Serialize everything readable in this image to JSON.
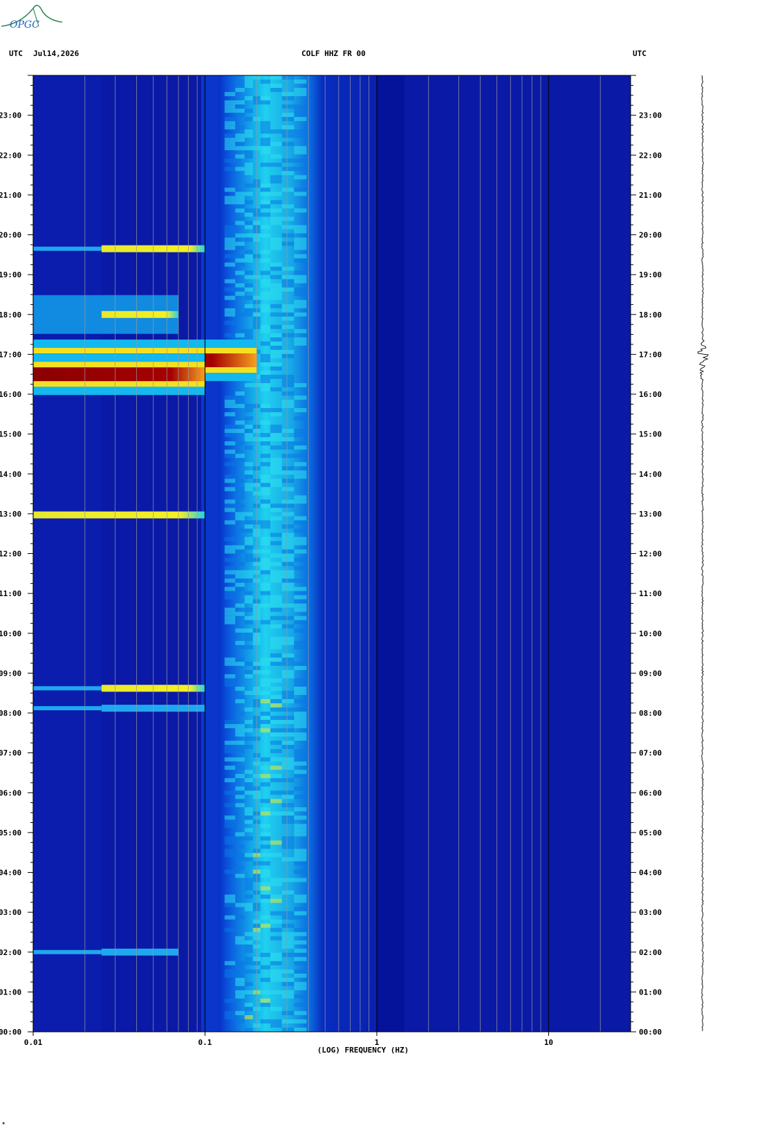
{
  "header": {
    "left_utc": "UTC",
    "date": "Jul14,2026",
    "station": "COLF HHZ FR 00",
    "right_utc": "UTC"
  },
  "logo": {
    "text": "OPGC",
    "color": "#2e8b57",
    "text_color": "#1e5fbf"
  },
  "colors": {
    "background": "#0a1aa6",
    "quiet_band": "#0825b8",
    "cyan": "#1fc8e8",
    "yellow": "#f5f020",
    "red": "#8b0000",
    "grid_line": "#9a9a9a"
  },
  "chart_data": {
    "type": "heatmap",
    "title": "COLF HHZ FR 00",
    "xlabel": "(LOG) FREQUENCY (HZ)",
    "ylabel": "UTC",
    "x_scale": "log",
    "xlim": [
      0.01,
      30
    ],
    "ylim": [
      "00:00",
      "24:00"
    ],
    "x_ticks": [
      {
        "value": 0.01,
        "label": "0.01"
      },
      {
        "value": 0.1,
        "label": "0.1"
      },
      {
        "value": 1,
        "label": "1"
      },
      {
        "value": 10,
        "label": "10"
      }
    ],
    "y_ticks": [
      "00:00",
      "01:00",
      "02:00",
      "03:00",
      "04:00",
      "05:00",
      "06:00",
      "07:00",
      "08:00",
      "09:00",
      "10:00",
      "11:00",
      "12:00",
      "13:00",
      "14:00",
      "15:00",
      "16:00",
      "17:00",
      "18:00",
      "19:00",
      "20:00",
      "21:00",
      "22:00",
      "23:00"
    ],
    "microseism_band_hz": [
      0.12,
      0.48
    ],
    "microseism_peak_hz": 0.2,
    "events": [
      {
        "time_h": 16.85,
        "f_min_hz": 0.01,
        "f_max_hz": 0.2,
        "level": "very high"
      },
      {
        "time_h": 16.5,
        "f_min_hz": 0.01,
        "f_max_hz": 0.1,
        "level": "very high"
      },
      {
        "time_h": 18.0,
        "f_min_hz": 0.025,
        "f_max_hz": 0.07,
        "level": "high"
      },
      {
        "time_h": 19.65,
        "f_min_hz": 0.025,
        "f_max_hz": 0.1,
        "level": "medium"
      },
      {
        "time_h": 12.97,
        "f_min_hz": 0.01,
        "f_max_hz": 0.1,
        "level": "medium"
      },
      {
        "time_h": 8.62,
        "f_min_hz": 0.025,
        "f_max_hz": 0.1,
        "level": "medium"
      },
      {
        "time_h": 8.12,
        "f_min_hz": 0.025,
        "f_max_hz": 0.1,
        "level": "low"
      },
      {
        "time_h": 2.0,
        "f_min_hz": 0.025,
        "f_max_hz": 0.07,
        "level": "low"
      }
    ],
    "seismogram_event_time_h": 16.9
  },
  "right_y_ticks": [
    "00:00",
    "01:00",
    "02:00",
    "03:00",
    "04:00",
    "05:00",
    "06:00",
    "07:00",
    "08:00",
    "09:00",
    "10:00",
    "11:00",
    "12:00",
    "13:00",
    "14:00",
    "15:00",
    "16:00",
    "17:00",
    "18:00",
    "19:00",
    "20:00",
    "21:00",
    "22:00",
    "23:00"
  ]
}
